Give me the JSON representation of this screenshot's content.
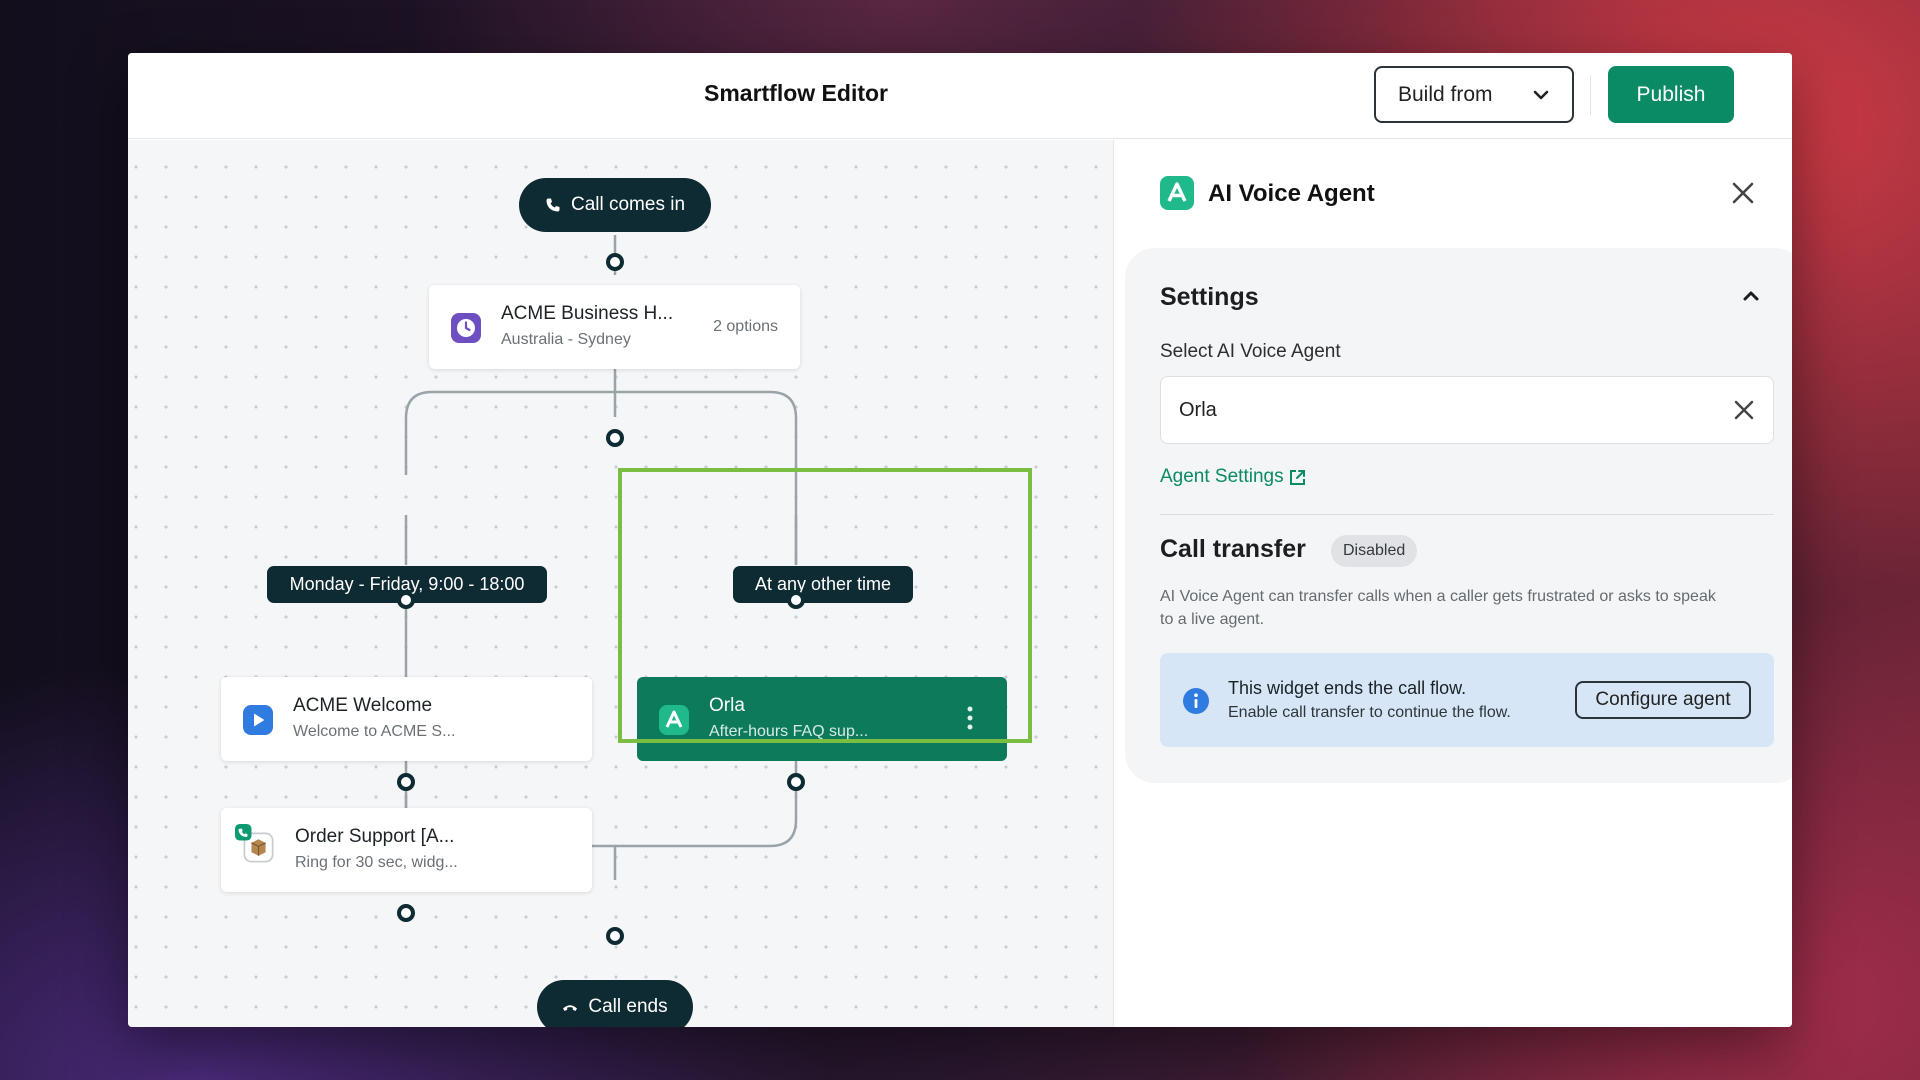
{
  "header": {
    "title": "Smartflow Editor",
    "build_label": "Build from",
    "publish_label": "Publish"
  },
  "flow": {
    "start_label": "Call comes in",
    "end_label": "Call ends",
    "business_hours": {
      "title": "ACME Business H...",
      "subtitle": "Australia - Sydney",
      "options": "2 options"
    },
    "branch_left_label": "Monday - Friday, 9:00 - 18:00",
    "branch_right_label": "At any other time",
    "welcome": {
      "title": "ACME Welcome",
      "subtitle": "Welcome to ACME S..."
    },
    "order_support": {
      "title": "Order Support [A...",
      "subtitle": "Ring for 30 sec, widg..."
    },
    "orla": {
      "title": "Orla",
      "subtitle": "After-hours FAQ sup..."
    }
  },
  "panel": {
    "title": "AI Voice Agent",
    "settings_title": "Settings",
    "select_label": "Select AI Voice Agent",
    "selected_value": "Orla",
    "agent_settings_link": "Agent Settings",
    "call_transfer_title": "Call transfer",
    "call_transfer_badge": "Disabled",
    "call_transfer_desc": "AI Voice Agent can transfer calls when a caller gets frustrated or asks to speak to a live agent.",
    "info_main": "This widget ends the call flow.",
    "info_sub": "Enable call transfer to continue the flow.",
    "configure_label": "Configure agent"
  },
  "colors": {
    "brand_green": "#0b8a66",
    "node_dark": "#0e2a33",
    "highlight": "#7abd43",
    "info_bg": "#d6e6f7"
  },
  "icons": {
    "start": "phone-icon",
    "end": "hang-up-icon",
    "business_hours": "clock-icon",
    "welcome": "play-icon",
    "order_support": "package-icon",
    "agent": "ai-agent-icon"
  }
}
